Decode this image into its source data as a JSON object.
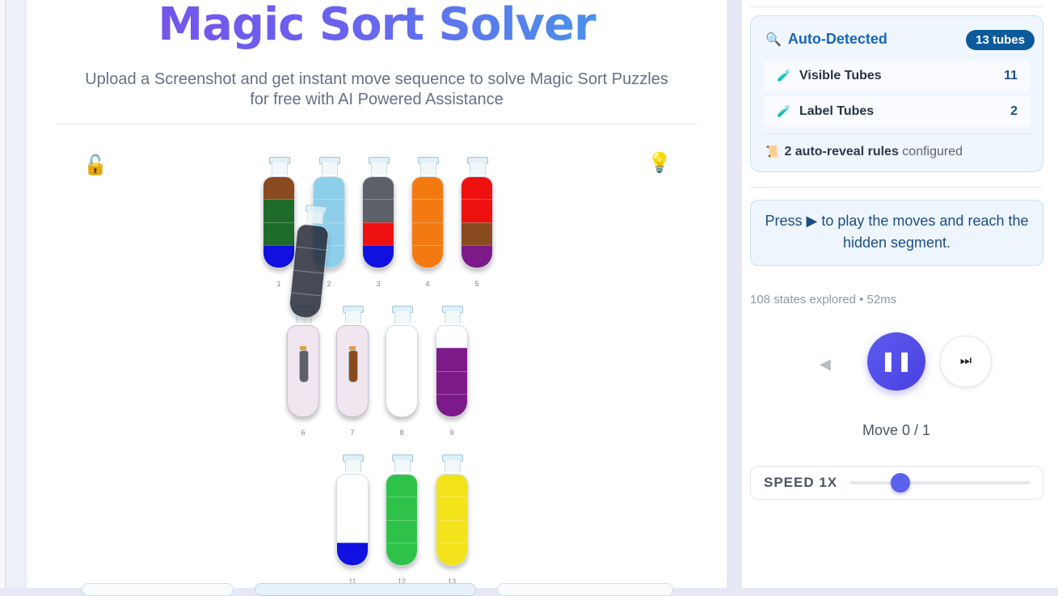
{
  "header": {
    "title": "Magic Sort Solver",
    "subtitle": "Upload a Screenshot and get instant move sequence to solve Magic Sort Puzzles for free with AI Powered Assistance"
  },
  "toolbar": {
    "lock_icon": "unlock-icon",
    "hint_icon": "lightbulb-icon"
  },
  "colors": {
    "brown": "#8a4a1f",
    "green": "#1e6b2a",
    "blue": "#1010e0",
    "lightblue": "#8dcfea",
    "gray": "#5c6068",
    "red": "#ef1010",
    "orange": "#f27a10",
    "purple": "#7d1a8a",
    "navy": "#1f2330",
    "white": "#ffffff",
    "brightgreen": "#2ec24a",
    "yellow": "#f2e31a"
  },
  "tubes": [
    {
      "number": "1",
      "segments": [
        "brown",
        "green",
        "green",
        "blue"
      ]
    },
    {
      "number": "2",
      "segments": [
        "lightblue",
        "lightblue",
        "lightblue",
        "lightblue"
      ]
    },
    {
      "number": "3",
      "segments": [
        "gray",
        "gray",
        "red",
        "blue"
      ]
    },
    {
      "number": "4",
      "segments": [
        "orange",
        "orange",
        "orange",
        "orange"
      ]
    },
    {
      "number": "5",
      "segments": [
        "red",
        "red",
        "brown",
        "purple"
      ]
    },
    {
      "number": "6",
      "segments": []
    },
    {
      "number": "7",
      "segments": []
    },
    {
      "number": "8",
      "segments": [
        "white",
        "white",
        "white",
        "white"
      ]
    },
    {
      "number": "9",
      "segments": [
        "white",
        "purple",
        "purple",
        "purple"
      ]
    },
    {
      "number": "11",
      "segments": [
        "white",
        "white",
        "white",
        "blue"
      ]
    },
    {
      "number": "12",
      "segments": [
        "brightgreen",
        "brightgreen",
        "brightgreen",
        "brightgreen"
      ]
    },
    {
      "number": "13",
      "segments": [
        "yellow",
        "yellow",
        "yellow",
        "yellow"
      ]
    }
  ],
  "label_tubes": {
    "6": {
      "inner_color": "gray"
    },
    "7": {
      "inner_color": "brown"
    }
  },
  "floating_tube": {
    "segments": [
      "navy",
      "navy",
      "navy",
      "navy"
    ]
  },
  "detection": {
    "heading": "Auto-Detected",
    "heading_icon": "magnifier-icon",
    "badge": "13 tubes",
    "visible_label": "Visible Tubes",
    "visible_count": "11",
    "visible_icon": "test-tube-icon",
    "label_label": "Label Tubes",
    "label_count": "2",
    "label_icon": "red-tube-icon",
    "rules_bold": "2 auto-reveal rules",
    "rules_rest": "configured",
    "rules_icon": "scroll-icon"
  },
  "instructions": {
    "text": "Press ▶ to play the moves and reach the hidden segment."
  },
  "solver": {
    "stats": "108 states explored • 52ms",
    "move": "Move 0 / 1",
    "speed_label": "SPEED 1X",
    "speed_level": 0.28
  }
}
